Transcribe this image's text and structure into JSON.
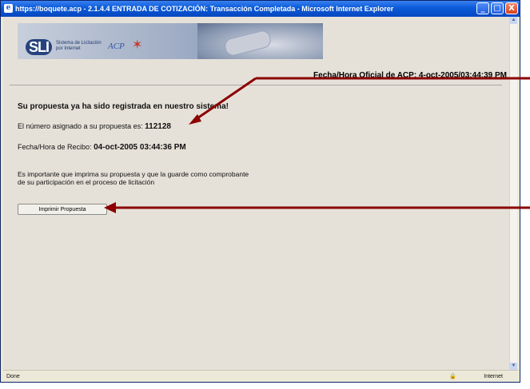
{
  "window": {
    "title": "https://boquete.acp - 2.1.4.4 ENTRADA DE COTIZACIÓN: Transacción Completada - Microsoft Internet Explorer",
    "buttons": {
      "minimize": "_",
      "maximize": "□",
      "close": "X"
    }
  },
  "banner": {
    "logo": "SLI",
    "subtitle_line1": "Sistema de Licitación",
    "subtitle_line2": "por Internet",
    "acp": "ACP"
  },
  "official_time": "Fecha/Hora Oficial de ACP: 4-oct-2005/03:44:39 PM",
  "confirmation": "Su propuesta ya ha sido registrada en nuestro sistema!",
  "proposal": {
    "label": "El número asignado a su propuesta es:",
    "value": "112128"
  },
  "receipt": {
    "label": "Fecha/Hora de Recibo:",
    "value": "04-oct-2005 03:44:36 PM"
  },
  "notice": {
    "line1": "Es importante que imprima su propuesta y que la guarde como comprobante",
    "line2": "de su participación en el proceso de licitación"
  },
  "print_button": "Imprimir Propuesta",
  "status": {
    "left": "Done",
    "zone": "Internet"
  },
  "colors": {
    "titlebar": "#0a5ad8",
    "page_bg": "#e6e1d8",
    "annotation_arrow": "#8b0000"
  }
}
